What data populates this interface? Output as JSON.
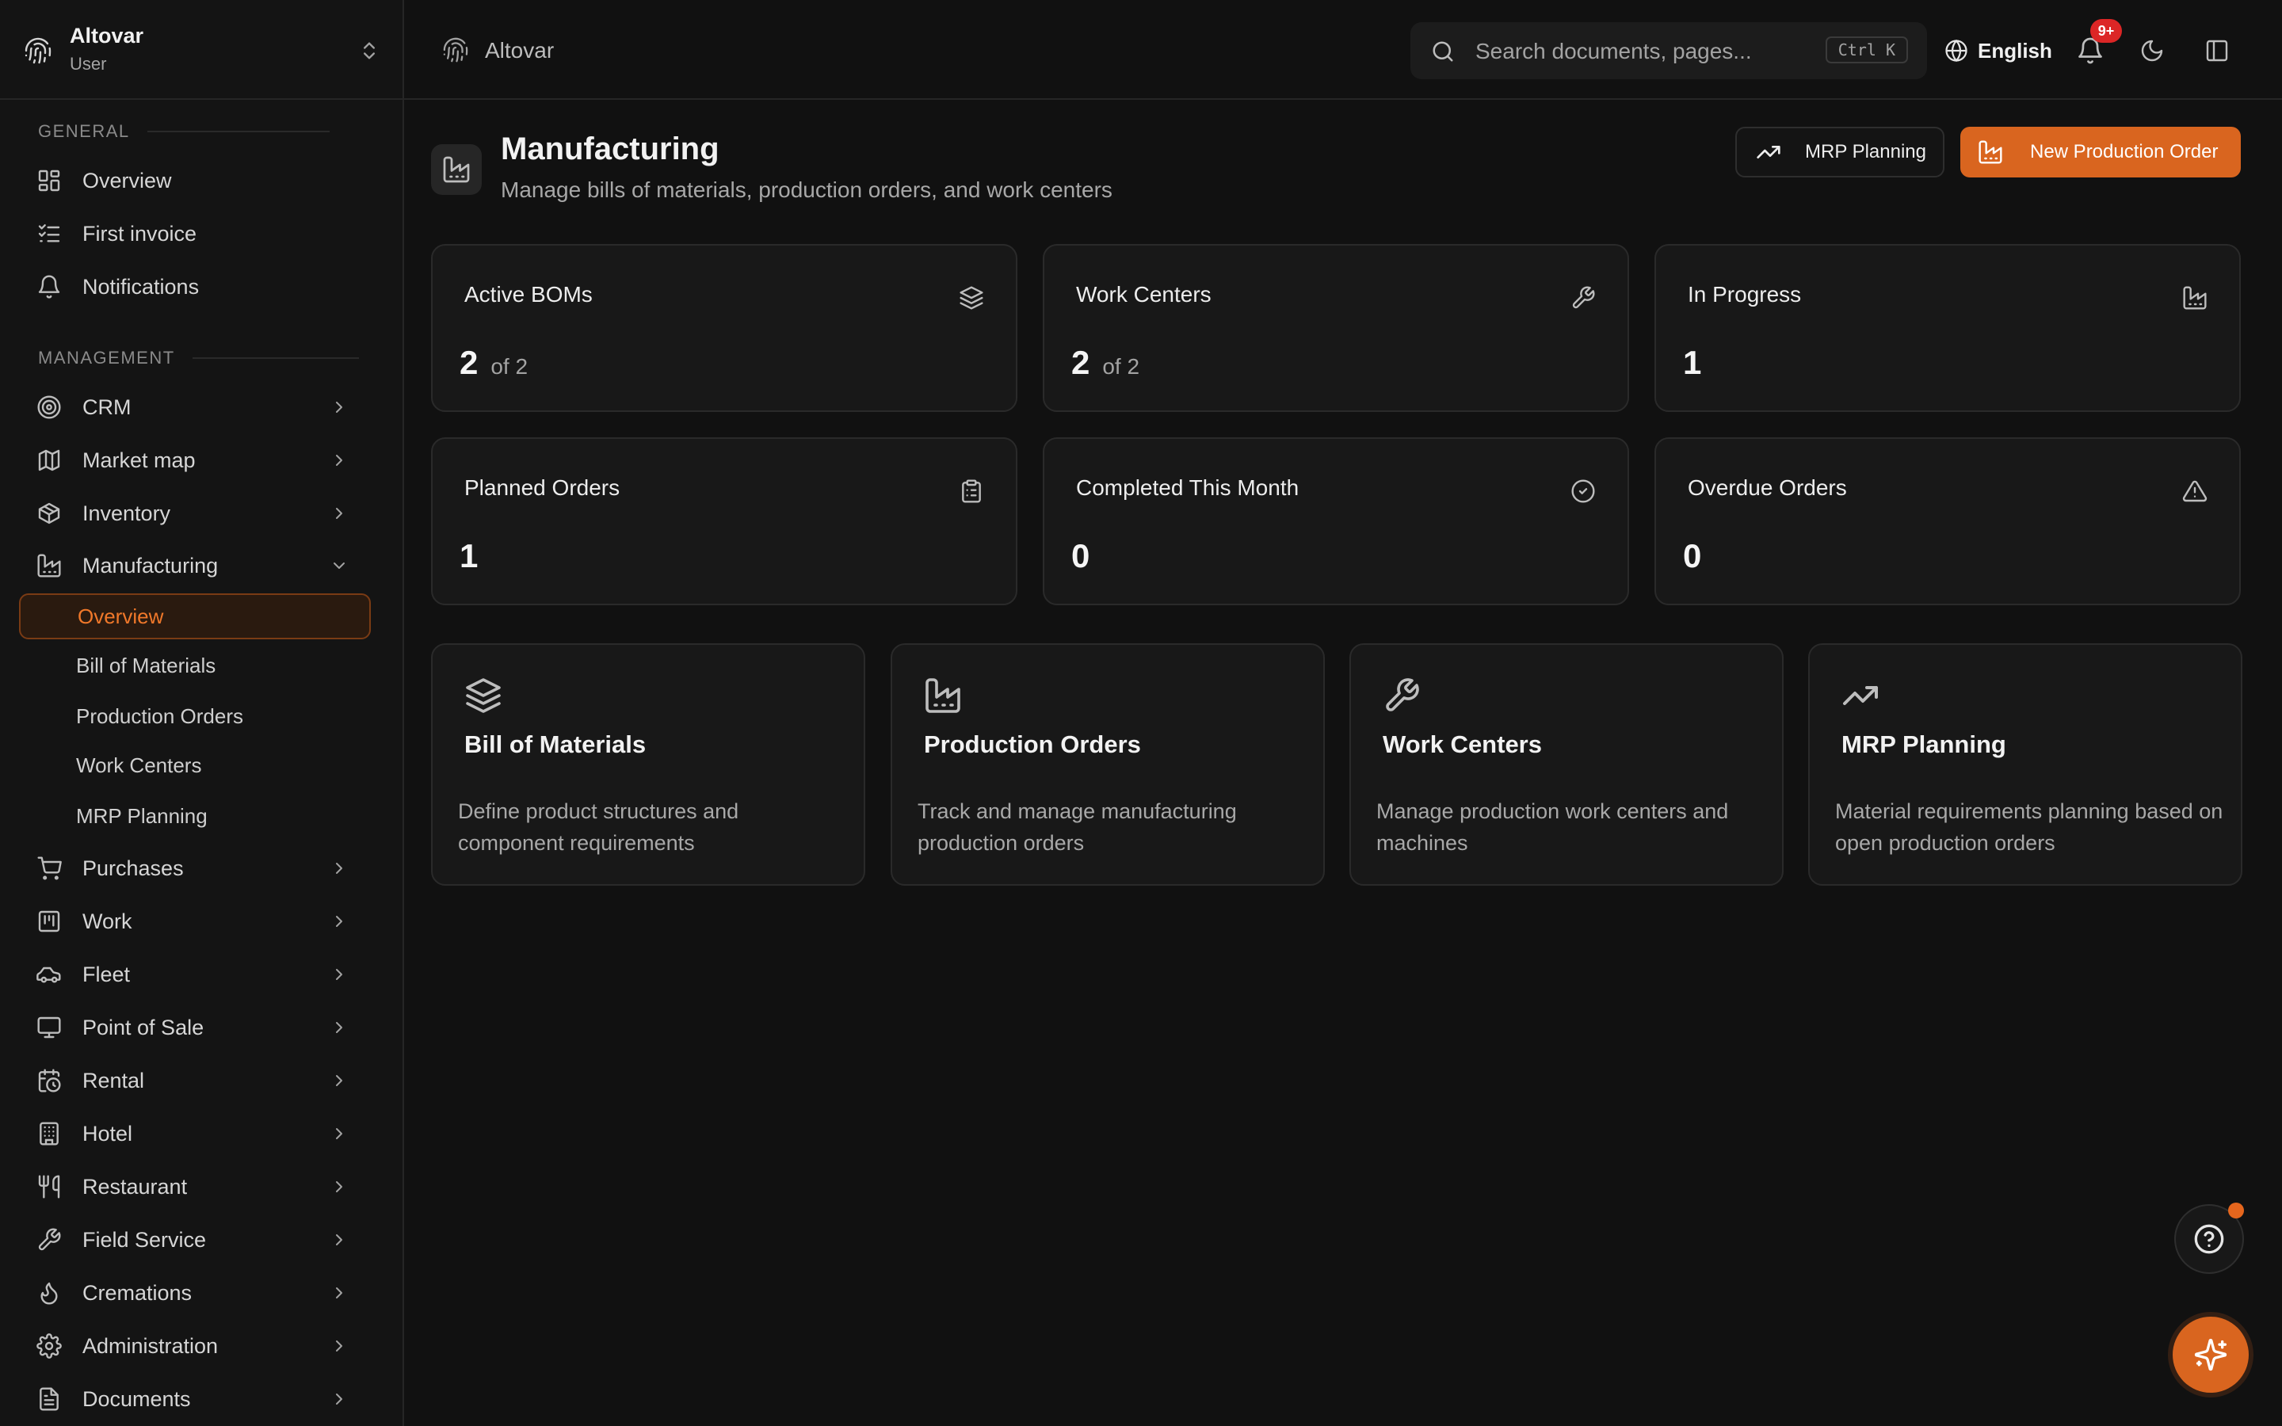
{
  "colors": {
    "accent": "#d9651f",
    "background": "#111111",
    "card": "#181818",
    "badge": "#dc2626"
  },
  "sidebar": {
    "app_name": "Altovar",
    "role": "User",
    "sections": {
      "general": "GENERAL",
      "management": "MANAGEMENT"
    },
    "general_items": [
      {
        "label": "Overview",
        "icon": "dashboard-icon"
      },
      {
        "label": "First invoice",
        "icon": "checklist-icon"
      },
      {
        "label": "Notifications",
        "icon": "bell-icon"
      }
    ],
    "management_items": [
      {
        "label": "CRM",
        "icon": "target-icon"
      },
      {
        "label": "Market map",
        "icon": "map-icon"
      },
      {
        "label": "Inventory",
        "icon": "package-icon"
      },
      {
        "label": "Manufacturing",
        "icon": "factory-icon"
      },
      {
        "label": "Purchases",
        "icon": "cart-icon"
      },
      {
        "label": "Work",
        "icon": "kanban-icon"
      },
      {
        "label": "Fleet",
        "icon": "car-icon"
      },
      {
        "label": "Point of Sale",
        "icon": "monitor-icon"
      },
      {
        "label": "Rental",
        "icon": "calendar-clock-icon"
      },
      {
        "label": "Hotel",
        "icon": "building-icon"
      },
      {
        "label": "Restaurant",
        "icon": "utensils-icon"
      },
      {
        "label": "Field Service",
        "icon": "wrench-icon"
      },
      {
        "label": "Cremations",
        "icon": "flame-icon"
      },
      {
        "label": "Administration",
        "icon": "gear-icon"
      },
      {
        "label": "Documents",
        "icon": "file-icon"
      }
    ],
    "manufacturing_sub": [
      {
        "label": "Overview",
        "active": true
      },
      {
        "label": "Bill of Materials"
      },
      {
        "label": "Production Orders"
      },
      {
        "label": "Work Centers"
      },
      {
        "label": "MRP Planning"
      }
    ]
  },
  "topbar": {
    "brand": "Altovar",
    "search_placeholder": "Search documents, pages...",
    "search_shortcut": "Ctrl K",
    "language": "English",
    "notification_count": "9+"
  },
  "page": {
    "title": "Manufacturing",
    "subtitle": "Manage bills of materials, production orders, and work centers",
    "buttons": {
      "mrp": "MRP Planning",
      "new_order": "New Production Order"
    }
  },
  "stats": [
    {
      "label": "Active BOMs",
      "value": "2",
      "of": "of 2",
      "icon": "layers-icon"
    },
    {
      "label": "Work Centers",
      "value": "2",
      "of": "of 2",
      "icon": "wrench-icon"
    },
    {
      "label": "In Progress",
      "value": "1",
      "icon": "factory-icon"
    },
    {
      "label": "Planned Orders",
      "value": "1",
      "icon": "clipboard-icon"
    },
    {
      "label": "Completed This Month",
      "value": "0",
      "icon": "check-circle-icon"
    },
    {
      "label": "Overdue Orders",
      "value": "0",
      "icon": "alert-triangle-icon"
    }
  ],
  "modules": [
    {
      "title": "Bill of Materials",
      "description": "Define product structures and component requirements",
      "icon": "layers-icon"
    },
    {
      "title": "Production Orders",
      "description": "Track and manage manufacturing production orders",
      "icon": "factory-icon"
    },
    {
      "title": "Work Centers",
      "description": "Manage production work centers and machines",
      "icon": "wrench-icon"
    },
    {
      "title": "MRP Planning",
      "description": "Material requirements planning based on open production orders",
      "icon": "trending-up-icon"
    }
  ]
}
